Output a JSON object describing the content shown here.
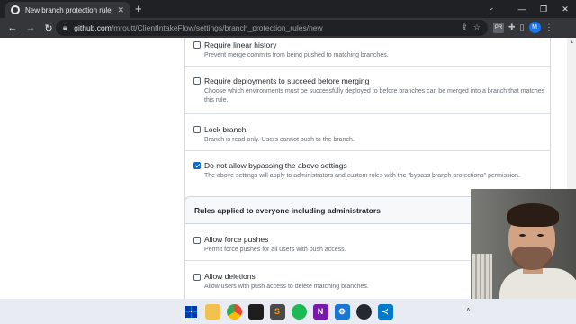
{
  "browser": {
    "tab_title": "New branch protection rule",
    "tab_close": "✕",
    "new_tab": "+",
    "url_host": "github.com",
    "url_path": "/mroutt/ClientIntakeFlow/settings/branch_protection_rules/new",
    "profile_initial": "M",
    "extension_badge": "PR",
    "window_controls": [
      "—",
      "❐",
      "✕"
    ]
  },
  "rules": [
    {
      "title": "Require linear history",
      "desc": "Prevent merge commits from being pushed to matching branches.",
      "checked": false
    },
    {
      "title": "Require deployments to succeed before merging",
      "desc": "Choose which environments must be successfully deployed to before branches can be merged into a branch that matches this rule.",
      "checked": false
    },
    {
      "title": "Lock branch",
      "desc": "Branch is read-only. Users cannot push to the branch.",
      "checked": false
    },
    {
      "title": "Do not allow bypassing the above settings",
      "desc": "The above settings will apply to administrators and custom roles with the \"bypass branch protections\" permission.",
      "checked": true
    }
  ],
  "admin_section": {
    "title": "Rules applied to everyone including administrators",
    "rules": [
      {
        "title": "Allow force pushes",
        "desc": "Permit force pushes for all users with push access.",
        "checked": false
      },
      {
        "title": "Allow deletions",
        "desc": "Allow users with push access to delete matching branches.",
        "checked": false
      }
    ]
  },
  "taskbar": {
    "icons": [
      "windows-start-icon",
      "file-explorer-icon",
      "chrome-icon",
      "terminal-icon",
      "sublime-icon",
      "spotify-icon",
      "onenote-icon",
      "app-icon",
      "github-desktop-icon",
      "vscode-icon"
    ]
  },
  "colors": {
    "accent": "#0969da",
    "chrome_dark": "#202124",
    "chrome_toolbar": "#35363a"
  }
}
